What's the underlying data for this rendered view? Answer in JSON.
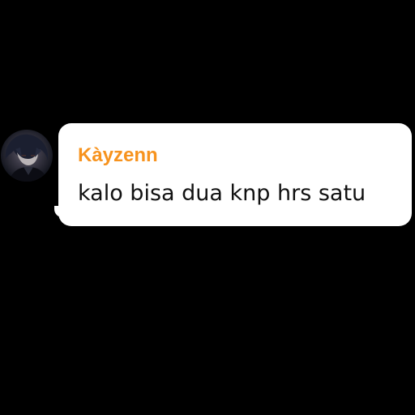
{
  "chat": {
    "sender_name": "Kàyzenn",
    "message_text": "kalo bisa dua knp hrs satu",
    "avatar_icon": "user-avatar-icon",
    "sender_color": "#f7931e",
    "bubble_color": "#ffffff",
    "background_color": "#000000"
  }
}
